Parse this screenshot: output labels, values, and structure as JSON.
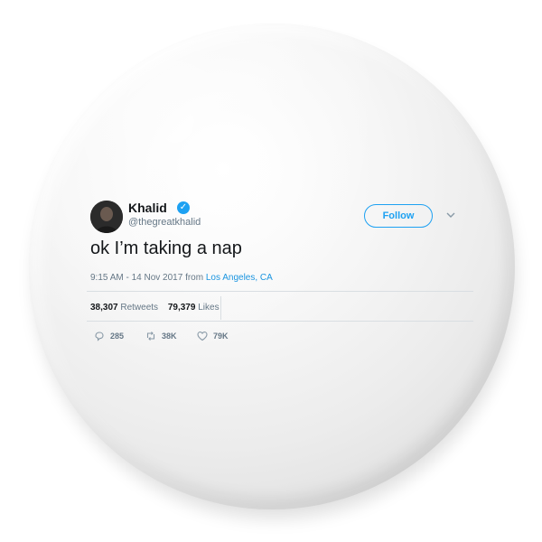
{
  "tweet": {
    "name": "Khalid",
    "handle": "@thegreatkhalid",
    "follow_label": "Follow",
    "text": "ok I’m taking a nap",
    "time": "9:15 AM - 14 Nov 2017",
    "from_word": "from",
    "location": "Los Angeles, CA",
    "retweets_count": "38,307",
    "retweets_label": "Retweets",
    "likes_count": "79,379",
    "likes_label": "Likes",
    "reply_count": "285",
    "retweet_action_count": "38K",
    "like_action_count": "79K"
  },
  "icons": {
    "verified": "verified-badge-icon",
    "chevron": "chevron-down-icon",
    "reply": "reply-icon",
    "retweet": "retweet-icon",
    "like": "heart-icon"
  },
  "colors": {
    "accent": "#1da1f2",
    "text": "#14171a",
    "muted": "#657786",
    "link": "#1b95e0",
    "pin_surface": "#f2f2f2"
  }
}
